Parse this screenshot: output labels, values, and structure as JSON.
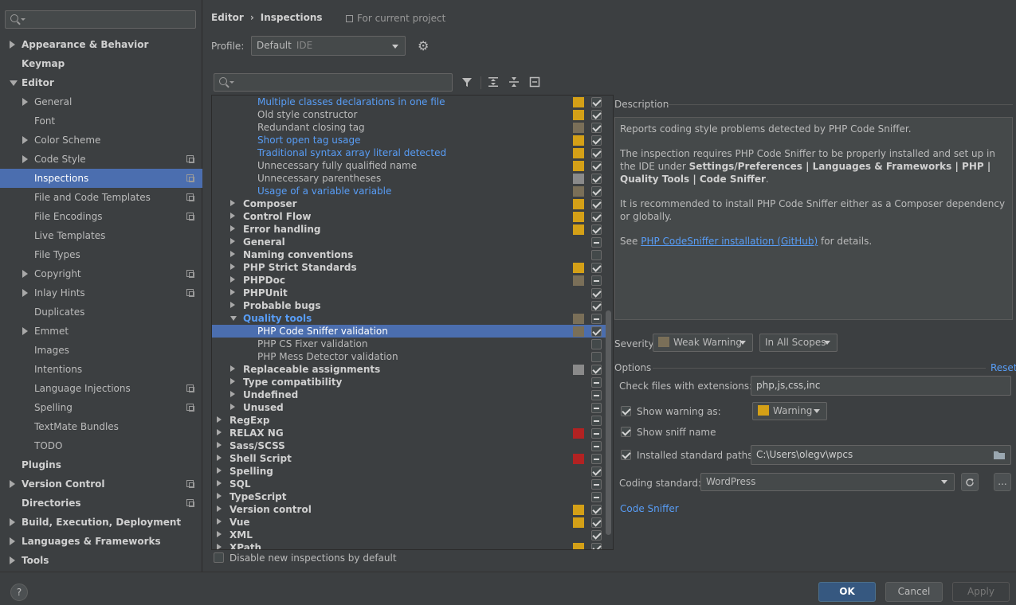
{
  "sidebar": {
    "search_placeholder": "",
    "items": [
      {
        "label": "Appearance & Behavior",
        "level": 0,
        "bold": true,
        "arrow": "right",
        "project": false
      },
      {
        "label": "Keymap",
        "level": 0,
        "bold": true,
        "arrow": "",
        "project": false
      },
      {
        "label": "Editor",
        "level": 0,
        "bold": true,
        "arrow": "down",
        "project": false
      },
      {
        "label": "General",
        "level": 1,
        "bold": false,
        "arrow": "right",
        "project": false
      },
      {
        "label": "Font",
        "level": 1,
        "bold": false,
        "arrow": "",
        "project": false
      },
      {
        "label": "Color Scheme",
        "level": 1,
        "bold": false,
        "arrow": "right",
        "project": false
      },
      {
        "label": "Code Style",
        "level": 1,
        "bold": false,
        "arrow": "right",
        "project": true
      },
      {
        "label": "Inspections",
        "level": 1,
        "bold": false,
        "arrow": "",
        "project": true,
        "selected": true
      },
      {
        "label": "File and Code Templates",
        "level": 1,
        "bold": false,
        "arrow": "",
        "project": true
      },
      {
        "label": "File Encodings",
        "level": 1,
        "bold": false,
        "arrow": "",
        "project": true
      },
      {
        "label": "Live Templates",
        "level": 1,
        "bold": false,
        "arrow": "",
        "project": false
      },
      {
        "label": "File Types",
        "level": 1,
        "bold": false,
        "arrow": "",
        "project": false
      },
      {
        "label": "Copyright",
        "level": 1,
        "bold": false,
        "arrow": "right",
        "project": true
      },
      {
        "label": "Inlay Hints",
        "level": 1,
        "bold": false,
        "arrow": "right",
        "project": true
      },
      {
        "label": "Duplicates",
        "level": 1,
        "bold": false,
        "arrow": "",
        "project": false
      },
      {
        "label": "Emmet",
        "level": 1,
        "bold": false,
        "arrow": "right",
        "project": false
      },
      {
        "label": "Images",
        "level": 1,
        "bold": false,
        "arrow": "",
        "project": false
      },
      {
        "label": "Intentions",
        "level": 1,
        "bold": false,
        "arrow": "",
        "project": false
      },
      {
        "label": "Language Injections",
        "level": 1,
        "bold": false,
        "arrow": "",
        "project": true
      },
      {
        "label": "Spelling",
        "level": 1,
        "bold": false,
        "arrow": "",
        "project": true
      },
      {
        "label": "TextMate Bundles",
        "level": 1,
        "bold": false,
        "arrow": "",
        "project": false
      },
      {
        "label": "TODO",
        "level": 1,
        "bold": false,
        "arrow": "",
        "project": false
      },
      {
        "label": "Plugins",
        "level": 0,
        "bold": true,
        "arrow": "",
        "project": false
      },
      {
        "label": "Version Control",
        "level": 0,
        "bold": true,
        "arrow": "right",
        "project": true
      },
      {
        "label": "Directories",
        "level": 0,
        "bold": true,
        "arrow": "",
        "project": true
      },
      {
        "label": "Build, Execution, Deployment",
        "level": 0,
        "bold": true,
        "arrow": "right",
        "project": false
      },
      {
        "label": "Languages & Frameworks",
        "level": 0,
        "bold": true,
        "arrow": "right",
        "project": false
      },
      {
        "label": "Tools",
        "level": 0,
        "bold": true,
        "arrow": "right",
        "project": false
      }
    ]
  },
  "header": {
    "breadcrumb_parent": "Editor",
    "breadcrumb_sep": "›",
    "breadcrumb_current": "Inspections",
    "for_project": "For current project",
    "profile_label": "Profile:",
    "profile_value": "Default",
    "profile_sub": "IDE"
  },
  "colors": {
    "warning": "#d4a017",
    "weak_warning": "#7a6f58",
    "error": "#b22222",
    "grey": "#8a8a8a",
    "selection": "#4b6eaf",
    "link": "#589df6"
  },
  "tree": {
    "search_placeholder": "",
    "rows": [
      {
        "label": "Multiple classes declarations in one file",
        "level": 2,
        "style": "link",
        "arrow": "",
        "sev": "warning",
        "check": "checked"
      },
      {
        "label": "Old style constructor",
        "level": 2,
        "style": "",
        "arrow": "",
        "sev": "warning",
        "check": "checked"
      },
      {
        "label": "Redundant closing tag",
        "level": 2,
        "style": "",
        "arrow": "",
        "sev": "weak_warning",
        "check": "checked"
      },
      {
        "label": "Short open tag usage",
        "level": 2,
        "style": "link",
        "arrow": "",
        "sev": "warning",
        "check": "checked"
      },
      {
        "label": "Traditional syntax array literal detected",
        "level": 2,
        "style": "link",
        "arrow": "",
        "sev": "warning",
        "check": "checked"
      },
      {
        "label": "Unnecessary fully qualified name",
        "level": 2,
        "style": "",
        "arrow": "",
        "sev": "warning",
        "check": "checked"
      },
      {
        "label": "Unnecessary parentheses",
        "level": 2,
        "style": "",
        "arrow": "",
        "sev": "grey",
        "check": "checked"
      },
      {
        "label": "Usage of a variable variable",
        "level": 2,
        "style": "link",
        "arrow": "",
        "sev": "weak_warning",
        "check": "checked"
      },
      {
        "label": "Composer",
        "level": 1,
        "style": "bold",
        "arrow": "right",
        "sev": "warning",
        "check": "checked"
      },
      {
        "label": "Control Flow",
        "level": 1,
        "style": "bold",
        "arrow": "right",
        "sev": "warning",
        "check": "checked"
      },
      {
        "label": "Error handling",
        "level": 1,
        "style": "bold",
        "arrow": "right",
        "sev": "warning",
        "check": "checked"
      },
      {
        "label": "General",
        "level": 1,
        "style": "bold",
        "arrow": "right",
        "sev": "",
        "check": "mixed"
      },
      {
        "label": "Naming conventions",
        "level": 1,
        "style": "bold",
        "arrow": "right",
        "sev": "",
        "check": ""
      },
      {
        "label": "PHP Strict Standards",
        "level": 1,
        "style": "bold",
        "arrow": "right",
        "sev": "warning",
        "check": "checked"
      },
      {
        "label": "PHPDoc",
        "level": 1,
        "style": "bold",
        "arrow": "right",
        "sev": "weak_warning",
        "check": "mixed"
      },
      {
        "label": "PHPUnit",
        "level": 1,
        "style": "bold",
        "arrow": "right",
        "sev": "",
        "check": "checked"
      },
      {
        "label": "Probable bugs",
        "level": 1,
        "style": "bold",
        "arrow": "right",
        "sev": "",
        "check": "checked"
      },
      {
        "label": "Quality tools",
        "level": 1,
        "style": "bold-link",
        "arrow": "down",
        "sev": "weak_warning",
        "check": "mixed"
      },
      {
        "label": "PHP Code Sniffer validation",
        "level": 2,
        "style": "",
        "arrow": "",
        "sev": "weak_warning",
        "check": "checked",
        "selected": true
      },
      {
        "label": "PHP CS Fixer validation",
        "level": 2,
        "style": "",
        "arrow": "",
        "sev": "",
        "check": ""
      },
      {
        "label": "PHP Mess Detector validation",
        "level": 2,
        "style": "",
        "arrow": "",
        "sev": "",
        "check": ""
      },
      {
        "label": "Replaceable assignments",
        "level": 1,
        "style": "bold",
        "arrow": "right",
        "sev": "grey",
        "check": "checked"
      },
      {
        "label": "Type compatibility",
        "level": 1,
        "style": "bold",
        "arrow": "right",
        "sev": "",
        "check": "mixed"
      },
      {
        "label": "Undefined",
        "level": 1,
        "style": "bold",
        "arrow": "right",
        "sev": "",
        "check": "mixed"
      },
      {
        "label": "Unused",
        "level": 1,
        "style": "bold",
        "arrow": "right",
        "sev": "",
        "check": "mixed"
      },
      {
        "label": "RegExp",
        "level": 0,
        "style": "bold",
        "arrow": "right",
        "sev": "",
        "check": "mixed"
      },
      {
        "label": "RELAX NG",
        "level": 0,
        "style": "bold",
        "arrow": "right",
        "sev": "error",
        "check": "mixed"
      },
      {
        "label": "Sass/SCSS",
        "level": 0,
        "style": "bold",
        "arrow": "right",
        "sev": "",
        "check": "mixed"
      },
      {
        "label": "Shell Script",
        "level": 0,
        "style": "bold",
        "arrow": "right",
        "sev": "error",
        "check": "mixed"
      },
      {
        "label": "Spelling",
        "level": 0,
        "style": "bold",
        "arrow": "right",
        "sev": "",
        "check": "checked"
      },
      {
        "label": "SQL",
        "level": 0,
        "style": "bold",
        "arrow": "right",
        "sev": "",
        "check": "mixed"
      },
      {
        "label": "TypeScript",
        "level": 0,
        "style": "bold",
        "arrow": "right",
        "sev": "",
        "check": "mixed"
      },
      {
        "label": "Version control",
        "level": 0,
        "style": "bold",
        "arrow": "right",
        "sev": "warning",
        "check": "checked"
      },
      {
        "label": "Vue",
        "level": 0,
        "style": "bold",
        "arrow": "right",
        "sev": "warning",
        "check": "checked"
      },
      {
        "label": "XML",
        "level": 0,
        "style": "bold",
        "arrow": "right",
        "sev": "",
        "check": "checked"
      },
      {
        "label": "XPath",
        "level": 0,
        "style": "bold",
        "arrow": "right",
        "sev": "warning",
        "check": "checked"
      }
    ],
    "disable_new_label": "Disable new inspections by default"
  },
  "description": {
    "title": "Description",
    "p1": "Reports coding style problems detected by PHP Code Sniffer.",
    "p2_pre": "The inspection requires PHP Code Sniffer to be properly installed and set up in the IDE under ",
    "p2_bold": "Settings/Preferences | Languages & Frameworks | PHP | Quality Tools | Code Sniffer",
    "p2_post": ".",
    "p3": "It is recommended to install PHP Code Sniffer either as a Composer dependency or globally.",
    "p4_pre": "See ",
    "p4_link": "PHP CodeSniffer installation (GitHub)",
    "p4_post": " for details."
  },
  "severity": {
    "label": "Severity:",
    "value": "Weak Warning",
    "scope": "In All Scopes"
  },
  "options": {
    "title": "Options",
    "reset": "Reset",
    "extensions_label": "Check files with extensions:",
    "extensions_value": "php,js,css,inc",
    "show_warning_label": "Show warning as:",
    "show_warning_value": "Warning",
    "show_sniff_label": "Show sniff name",
    "installed_paths_label": "Installed standard paths:",
    "installed_paths_value": "C:\\Users\\olegv\\wpcs",
    "coding_standard_label": "Coding standard:",
    "coding_standard_value": "WordPress",
    "more_button": "...",
    "code_sniffer_link": "Code Sniffer"
  },
  "footer": {
    "help": "?",
    "ok": "OK",
    "cancel": "Cancel",
    "apply": "Apply"
  }
}
